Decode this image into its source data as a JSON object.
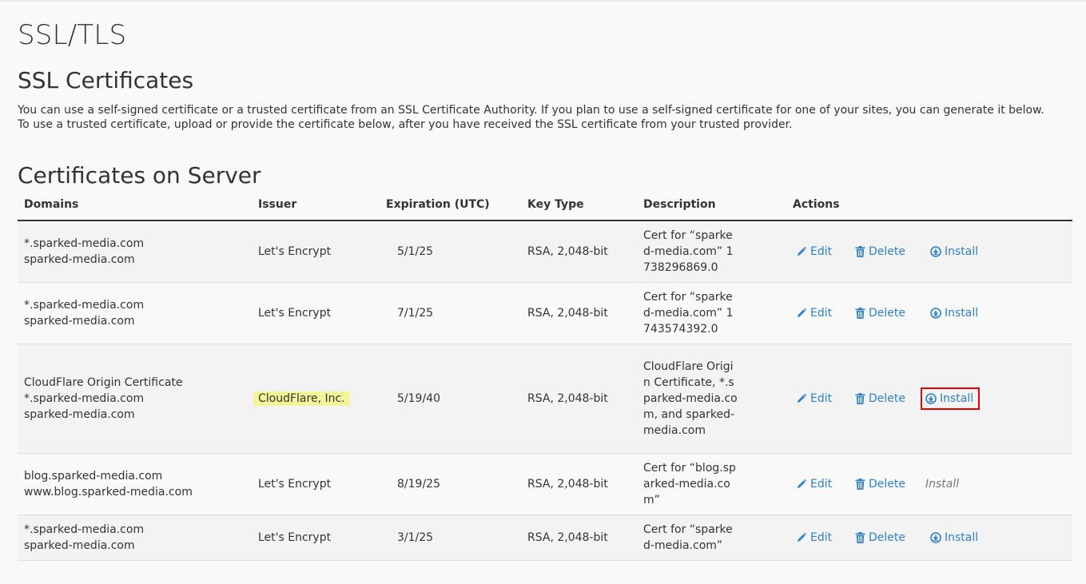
{
  "page": {
    "title": "SSL/TLS",
    "ssl_heading": "SSL Certificates",
    "description": "You can use a self-signed certificate or a trusted certificate from an SSL Certificate Authority. If you plan to use a self-signed certificate for one of your sites, you can generate it below. To use a trusted certificate, upload or provide the certificate below, after you have received the SSL certificate from your trusted provider.",
    "certs_heading": "Certificates on Server"
  },
  "table": {
    "headers": {
      "domains": "Domains",
      "issuer": "Issuer",
      "expiration": "Expiration (UTC)",
      "key_type": "Key Type",
      "description": "Description",
      "actions": "Actions"
    },
    "actions": {
      "edit": "Edit",
      "delete": "Delete",
      "install": "Install"
    },
    "rows": [
      {
        "domain1": "*.sparked-media.com",
        "domain2": "sparked-media.com",
        "domain3": "",
        "issuer": "Let's Encrypt",
        "expiration": "5/1/25",
        "key_type": "RSA, 2,048-bit",
        "description": "Cert for “sparked-media.com” 1738296869.0"
      },
      {
        "domain1": "*.sparked-media.com",
        "domain2": "sparked-media.com",
        "domain3": "",
        "issuer": "Let's Encrypt",
        "expiration": "7/1/25",
        "key_type": "RSA, 2,048-bit",
        "description": "Cert for “sparked-media.com” 1743574392.0"
      },
      {
        "domain1": "CloudFlare Origin Certificate",
        "domain2": "*.sparked-media.com",
        "domain3": "sparked-media.com",
        "issuer": "CloudFlare, Inc.",
        "expiration": "5/19/40",
        "key_type": "RSA, 2,048-bit",
        "description": "CloudFlare Origin Certificate, *.sparked-media.com, and sparked-media.com"
      },
      {
        "domain1": "blog.sparked-media.com",
        "domain2": "www.blog.sparked-media.com",
        "domain3": "",
        "issuer": "Let's Encrypt",
        "expiration": "8/19/25",
        "key_type": "RSA, 2,048-bit",
        "description": "Cert for “blog.sparked-media.com”"
      },
      {
        "domain1": "*.sparked-media.com",
        "domain2": "sparked-media.com",
        "domain3": "",
        "issuer": "Let's Encrypt",
        "expiration": "3/1/25",
        "key_type": "RSA, 2,048-bit",
        "description": "Cert for “sparked-media.com”"
      }
    ]
  },
  "colors": {
    "link": "#2f80c5",
    "highlight_box": "#e40000",
    "issuer_highlight": "#f4f49a"
  },
  "icons": {
    "edit": "pencil-icon",
    "delete": "trash-icon",
    "install": "download-circle-icon"
  }
}
